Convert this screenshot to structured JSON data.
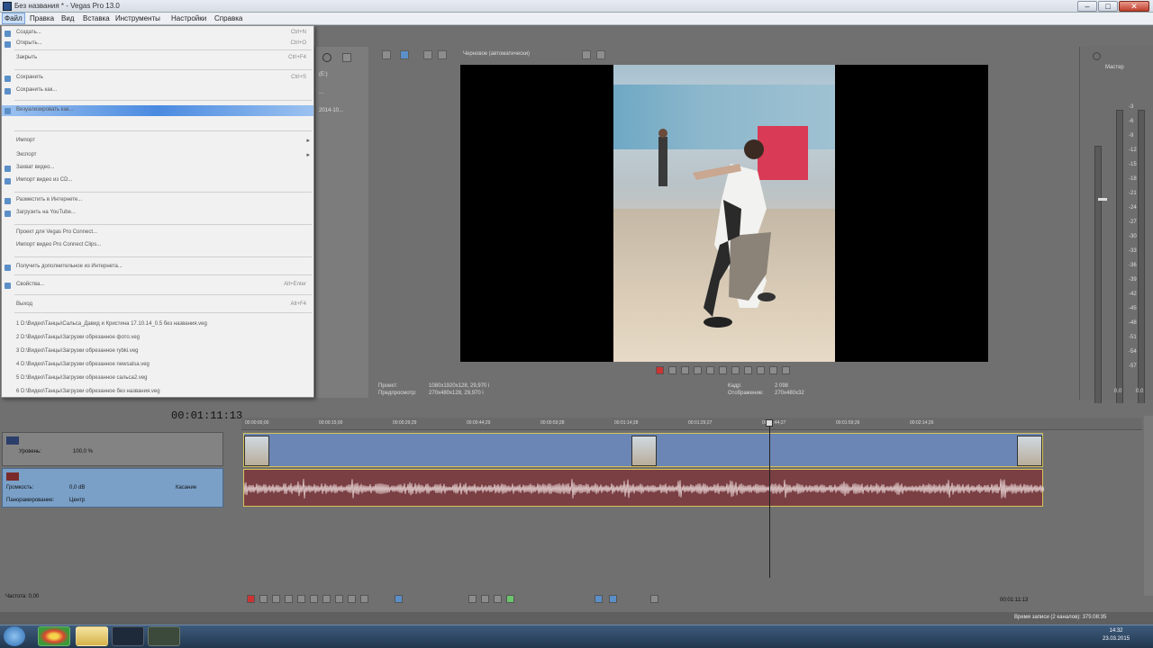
{
  "window": {
    "title": "Без названия * - Vegas Pro 13.0",
    "buttons": [
      "–",
      "□",
      "✕"
    ]
  },
  "menubar": {
    "items": [
      "Файл",
      "Правка",
      "Вид",
      "Вставка",
      "Инструменты",
      "Настройки",
      "Справка"
    ],
    "active": "Файл"
  },
  "file_menu": {
    "items": [
      {
        "label": "Создать...",
        "shortcut": "Ctrl+N",
        "icon": "new-file-icon"
      },
      {
        "label": "Открыть...",
        "shortcut": "Ctrl+O",
        "icon": "open-folder-icon"
      },
      {
        "label": "Закрыть",
        "shortcut": "Ctrl+F4",
        "icon": ""
      },
      {
        "label": "Сохранить",
        "shortcut": "Ctrl+S",
        "icon": "save-icon"
      },
      {
        "label": "Сохранить как...",
        "shortcut": "",
        "icon": "save-as-icon"
      },
      {
        "label": "Визуализировать как...",
        "shortcut": "",
        "icon": "render-icon",
        "highlight": true
      },
      {
        "label": "Импорт",
        "shortcut": "",
        "icon": "",
        "submenu": true
      },
      {
        "label": "Экспорт",
        "shortcut": "",
        "icon": "",
        "submenu": true
      },
      {
        "label": "Захват видео...",
        "shortcut": "",
        "icon": "capture-icon"
      },
      {
        "label": "Импорт видео из CD...",
        "shortcut": "",
        "icon": "cd-icon"
      },
      {
        "label": "Разместить в Интернете...",
        "shortcut": "",
        "icon": "web-icon"
      },
      {
        "label": "Загрузить на YouTube...",
        "shortcut": "",
        "icon": "youtube-icon"
      },
      {
        "label": "Проект для Vegas Pro Connect...",
        "shortcut": "",
        "icon": ""
      },
      {
        "label": "Импорт видео Pro Connect Clips...",
        "shortcut": "",
        "icon": ""
      },
      {
        "label": "Получить дополнительное из Интернета...",
        "shortcut": "",
        "icon": "globe-icon"
      },
      {
        "label": "Свойства...",
        "shortcut": "Alt+Enter",
        "icon": "properties-icon"
      },
      {
        "label": "Выход",
        "shortcut": "Alt+F4",
        "icon": ""
      }
    ],
    "recent": [
      "1 D:\\Видео\\Танцы\\Сальса_Давид и Кристина 17.10.14_0.5 без названия.veg",
      "2 D:\\Видео\\Танцы\\Загрузки обрезанное фото.veg",
      "3 D:\\Видео\\Танцы\\Загрузки обрезанное rybki.veg",
      "4 D:\\Видео\\Танцы\\Загрузки обрезанное newsalsa.veg",
      "5 D:\\Видео\\Танцы\\Загрузки обрезанное сальса2.veg",
      "6 D:\\Видео\\Танцы\\Загрузки обрезанное без названия.veg"
    ]
  },
  "explorer": {
    "items": [
      "(E:)",
      "...",
      "2014-10..."
    ]
  },
  "preview": {
    "mode": "Черновое (автоматически)",
    "project_label": "Проект:",
    "project_value": "1080x1920x128, 29,970 i",
    "preview_label": "Предпросмотр:",
    "preview_value": "270x480x128, 29,970 i",
    "frame_label": "Кадр:",
    "frame_value": "2 098",
    "display_label": "Отображение:",
    "display_value": "270x480x32"
  },
  "meter": {
    "label": "Мастер",
    "scale": [
      "-3",
      "-6",
      "-9",
      "-12",
      "-15",
      "-18",
      "-21",
      "-24",
      "-27",
      "-30",
      "-33",
      "-36",
      "-39",
      "-42",
      "-45",
      "-48",
      "-51",
      "-54",
      "-57"
    ],
    "bottom": [
      "0.0",
      "0.0"
    ]
  },
  "timeline": {
    "timecode": "00:01:11:13",
    "ruler": [
      "00:00:00;00",
      "00:00:15;00",
      "00:00:29;29",
      "00:00:44;29",
      "00:00:59;28",
      "00:01:14;28",
      "00:01:29;27",
      "00:01:44;27",
      "00:01:59;26",
      "00:02:14;26"
    ],
    "video_track": {
      "label": "Уровень:",
      "value": "100,0 %"
    },
    "audio_track": {
      "volume_label": "Громкость:",
      "volume_value": "0,0 dB",
      "pan_label": "Панорамирование:",
      "pan_value": "Центр",
      "touch": "Касание"
    },
    "rate": "Частота: 0,00"
  },
  "status": {
    "record_time": "Время записи (2 каналов): 375:08:35",
    "position": "00:01:11:13"
  },
  "taskbar": {
    "time": "14:32",
    "date": "23.03.2015"
  },
  "colors": {
    "video_track": "#6b86b4",
    "audio_track": "#7a3f43",
    "clip_border": "#d6c35a",
    "highlight": "#4a8ae0"
  }
}
